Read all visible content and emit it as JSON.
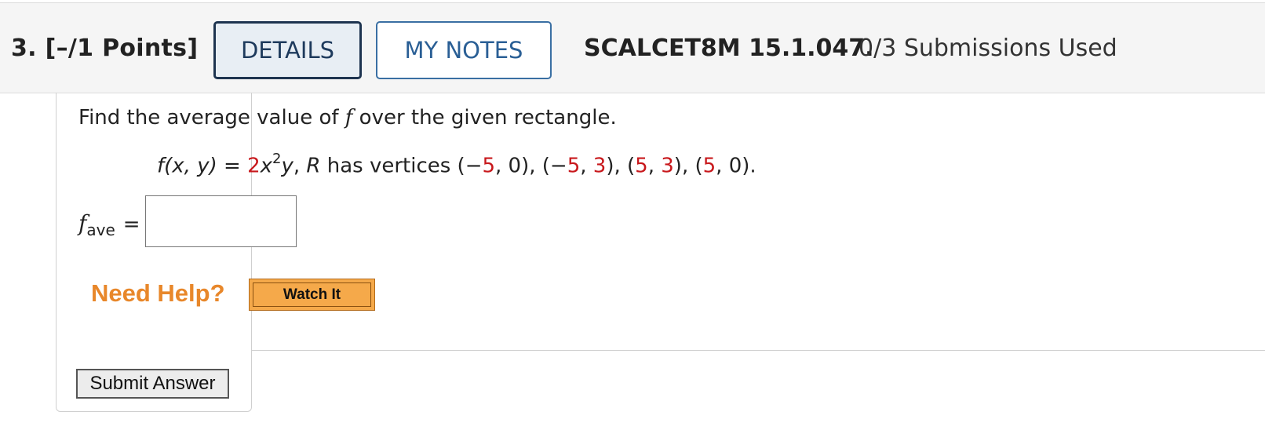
{
  "header": {
    "question_label": "3.  [–/1 Points]",
    "details_label": "DETAILS",
    "notes_label": "MY NOTES",
    "problem_code": "SCALCET8M 15.1.047.",
    "submissions": "0/3 Submissions Used"
  },
  "problem": {
    "prompt_before": "Find the average value of ",
    "prompt_var": "f",
    "prompt_after": " over the given rectangle.",
    "formula": {
      "lhs": "f(x, y)",
      "eq": " = ",
      "coef": "2",
      "base": "x",
      "exp": "2",
      "yvar": "y",
      "comma1": ", ",
      "R": "R",
      "has_vertices": " has vertices ",
      "v1_open": "(−",
      "v1_x": "5",
      "v1_rest": ", 0), (−",
      "v2_x": "5",
      "v2_sep": ", ",
      "v2_y": "3",
      "v2_close": "), (",
      "v3_x": "5",
      "v3_sep": ", ",
      "v3_y": "3",
      "v3_close": "), (",
      "v4_x": "5",
      "v4_close": ", 0)."
    },
    "answer_label_f": "f",
    "answer_label_sub": "ave",
    "answer_eq": "=",
    "answer_value": ""
  },
  "help": {
    "need_help": "Need Help?",
    "watch_it": "Watch It"
  },
  "submit_label": "Submit Answer",
  "colors": {
    "accent_orange": "#e8872a",
    "red_number": "#c8181c",
    "details_border": "#1e3450",
    "notes_border": "#3a6fa3"
  }
}
